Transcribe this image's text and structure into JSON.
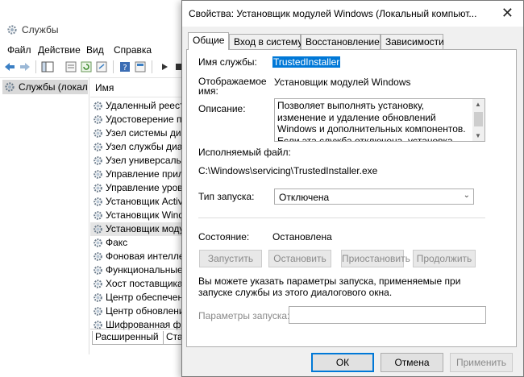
{
  "services_window": {
    "title": "Службы",
    "menu": [
      "Файл",
      "Действие",
      "Вид",
      "Справка"
    ],
    "tree_item": "Службы (локальн",
    "column_name": "Имя",
    "rows": [
      "Удаленный реестр",
      "Удостоверение при",
      "Узел системы диаг",
      "Узел службы диагн",
      "Узел универсальн",
      "Управление прило",
      "Управление уровн",
      "Установщик Active",
      "Установщик Windo",
      "Установщик модул",
      "Факс",
      "Фоновая интеллект",
      "Функциональные в",
      "Хост поставщика ф",
      "Центр обеспечени",
      "Центр обновления",
      "Шифрованная фай"
    ],
    "selected_row_index": 9,
    "bottom_tabs": [
      "Расширенный",
      "Ста"
    ]
  },
  "dialog": {
    "title": "Свойства: Установщик модулей Windows (Локальный компьют...",
    "close_glyph": "✕",
    "tabs": [
      "Общие",
      "Вход в систему",
      "Восстановление",
      "Зависимости"
    ],
    "service_name_label": "Имя службы:",
    "service_name_value": "TrustedInstaller",
    "display_name_label_1": "Отображаемое",
    "display_name_label_2": "имя:",
    "display_name_value": "Установщик модулей Windows",
    "description_label": "Описание:",
    "description_text": "Позволяет выполнять установку, изменение и удаление обновлений Windows и дополнительных компонентов. Если эта служба отключена, установка или удаление обновлений",
    "exe_label": "Исполняемый файл:",
    "exe_path": "C:\\Windows\\servicing\\TrustedInstaller.exe",
    "startup_type_label": "Тип запуска:",
    "startup_type_value": "Отключена",
    "status_label": "Состояние:",
    "status_value": "Остановлена",
    "btn_start": "Запустить",
    "btn_stop": "Остановить",
    "btn_pause": "Приостановить",
    "btn_resume": "Продолжить",
    "info_text": "Вы можете указать параметры запуска, применяемые при запуске службы из этого диалогового окна.",
    "params_label": "Параметры запуска:",
    "params_value": "",
    "btn_ok": "ОК",
    "btn_cancel": "Отмена",
    "btn_apply": "Применить"
  },
  "colors": {
    "selection": "#0078d7",
    "dialog_bg": "#f0f0f0",
    "disabled_text": "#8a8a8a"
  }
}
